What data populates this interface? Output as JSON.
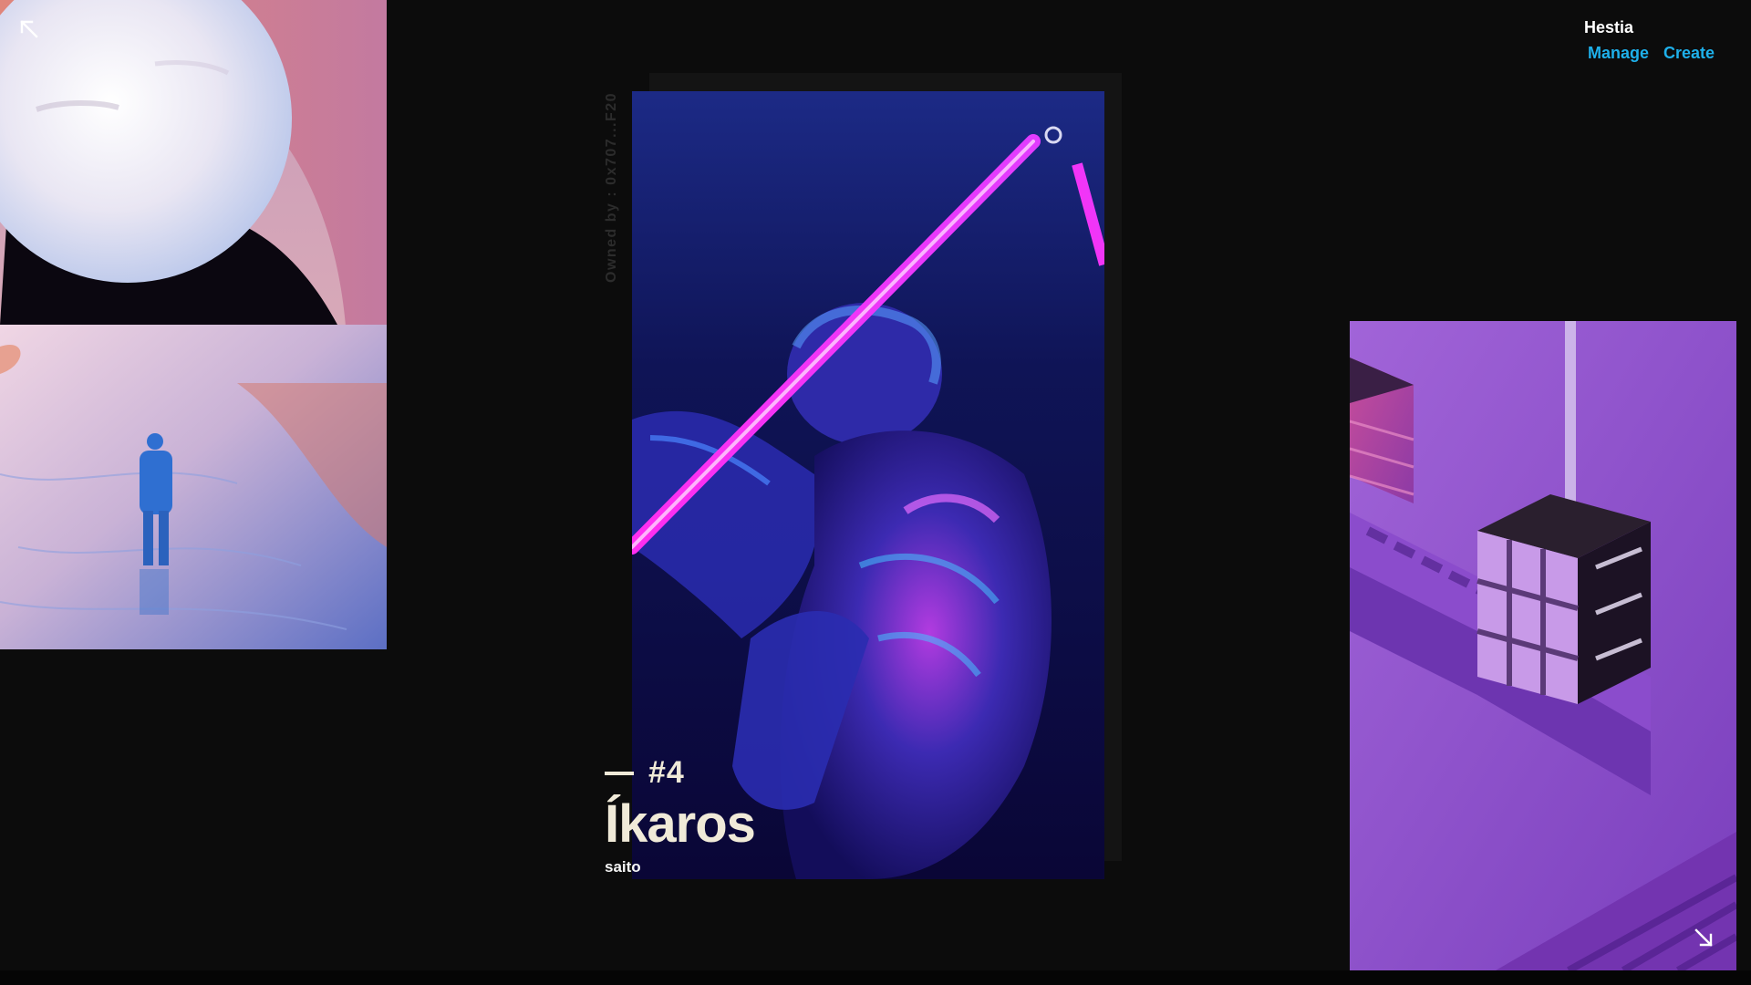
{
  "header": {
    "brand": "Hestia",
    "nav": [
      {
        "label": "Manage"
      },
      {
        "label": "Create"
      }
    ]
  },
  "featured": {
    "owner_text": "Owned by : 0x707...F20",
    "index": "#4",
    "title": "Íkaros",
    "artist": "saito"
  },
  "icons": {
    "collapse": "arrow-up-left-icon",
    "expand": "arrow-down-right-icon"
  },
  "colors": {
    "background": "#0c0c0c",
    "nav_link": "#1eb0ea",
    "caption": "#f0ead8"
  }
}
